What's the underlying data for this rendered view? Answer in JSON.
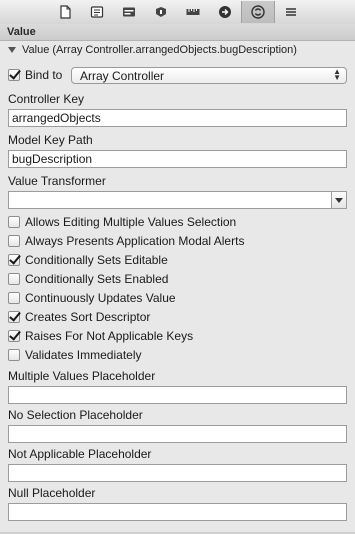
{
  "toolbar": {
    "icons": [
      "file-inspector-icon",
      "quick-help-icon",
      "identity-inspector-icon",
      "attributes-inspector-icon",
      "size-inspector-icon",
      "connections-inspector-icon",
      "bindings-inspector-icon",
      "view-effects-inspector-icon"
    ]
  },
  "section": {
    "title": "Value"
  },
  "binding": {
    "summary": "Value (Array Controller.arrangedObjects.bugDescription)",
    "bind_to_label": "Bind to",
    "bind_to_checked": true,
    "bind_to_value": "Array Controller"
  },
  "fields": {
    "controller_key_label": "Controller Key",
    "controller_key_value": "arrangedObjects",
    "model_key_path_label": "Model Key Path",
    "model_key_path_value": "bugDescription",
    "value_transformer_label": "Value Transformer",
    "value_transformer_value": ""
  },
  "options": [
    {
      "label": "Allows Editing Multiple Values Selection",
      "checked": false
    },
    {
      "label": "Always Presents Application Modal Alerts",
      "checked": false
    },
    {
      "label": "Conditionally Sets Editable",
      "checked": true
    },
    {
      "label": "Conditionally Sets Enabled",
      "checked": false
    },
    {
      "label": "Continuously Updates Value",
      "checked": false
    },
    {
      "label": "Creates Sort Descriptor",
      "checked": true
    },
    {
      "label": "Raises For Not Applicable Keys",
      "checked": true
    },
    {
      "label": "Validates Immediately",
      "checked": false
    }
  ],
  "placeholders": {
    "multiple_values_label": "Multiple Values Placeholder",
    "multiple_values_value": "",
    "no_selection_label": "No Selection Placeholder",
    "no_selection_value": "",
    "not_applicable_label": "Not Applicable Placeholder",
    "not_applicable_value": "",
    "null_label": "Null Placeholder",
    "null_value": ""
  }
}
